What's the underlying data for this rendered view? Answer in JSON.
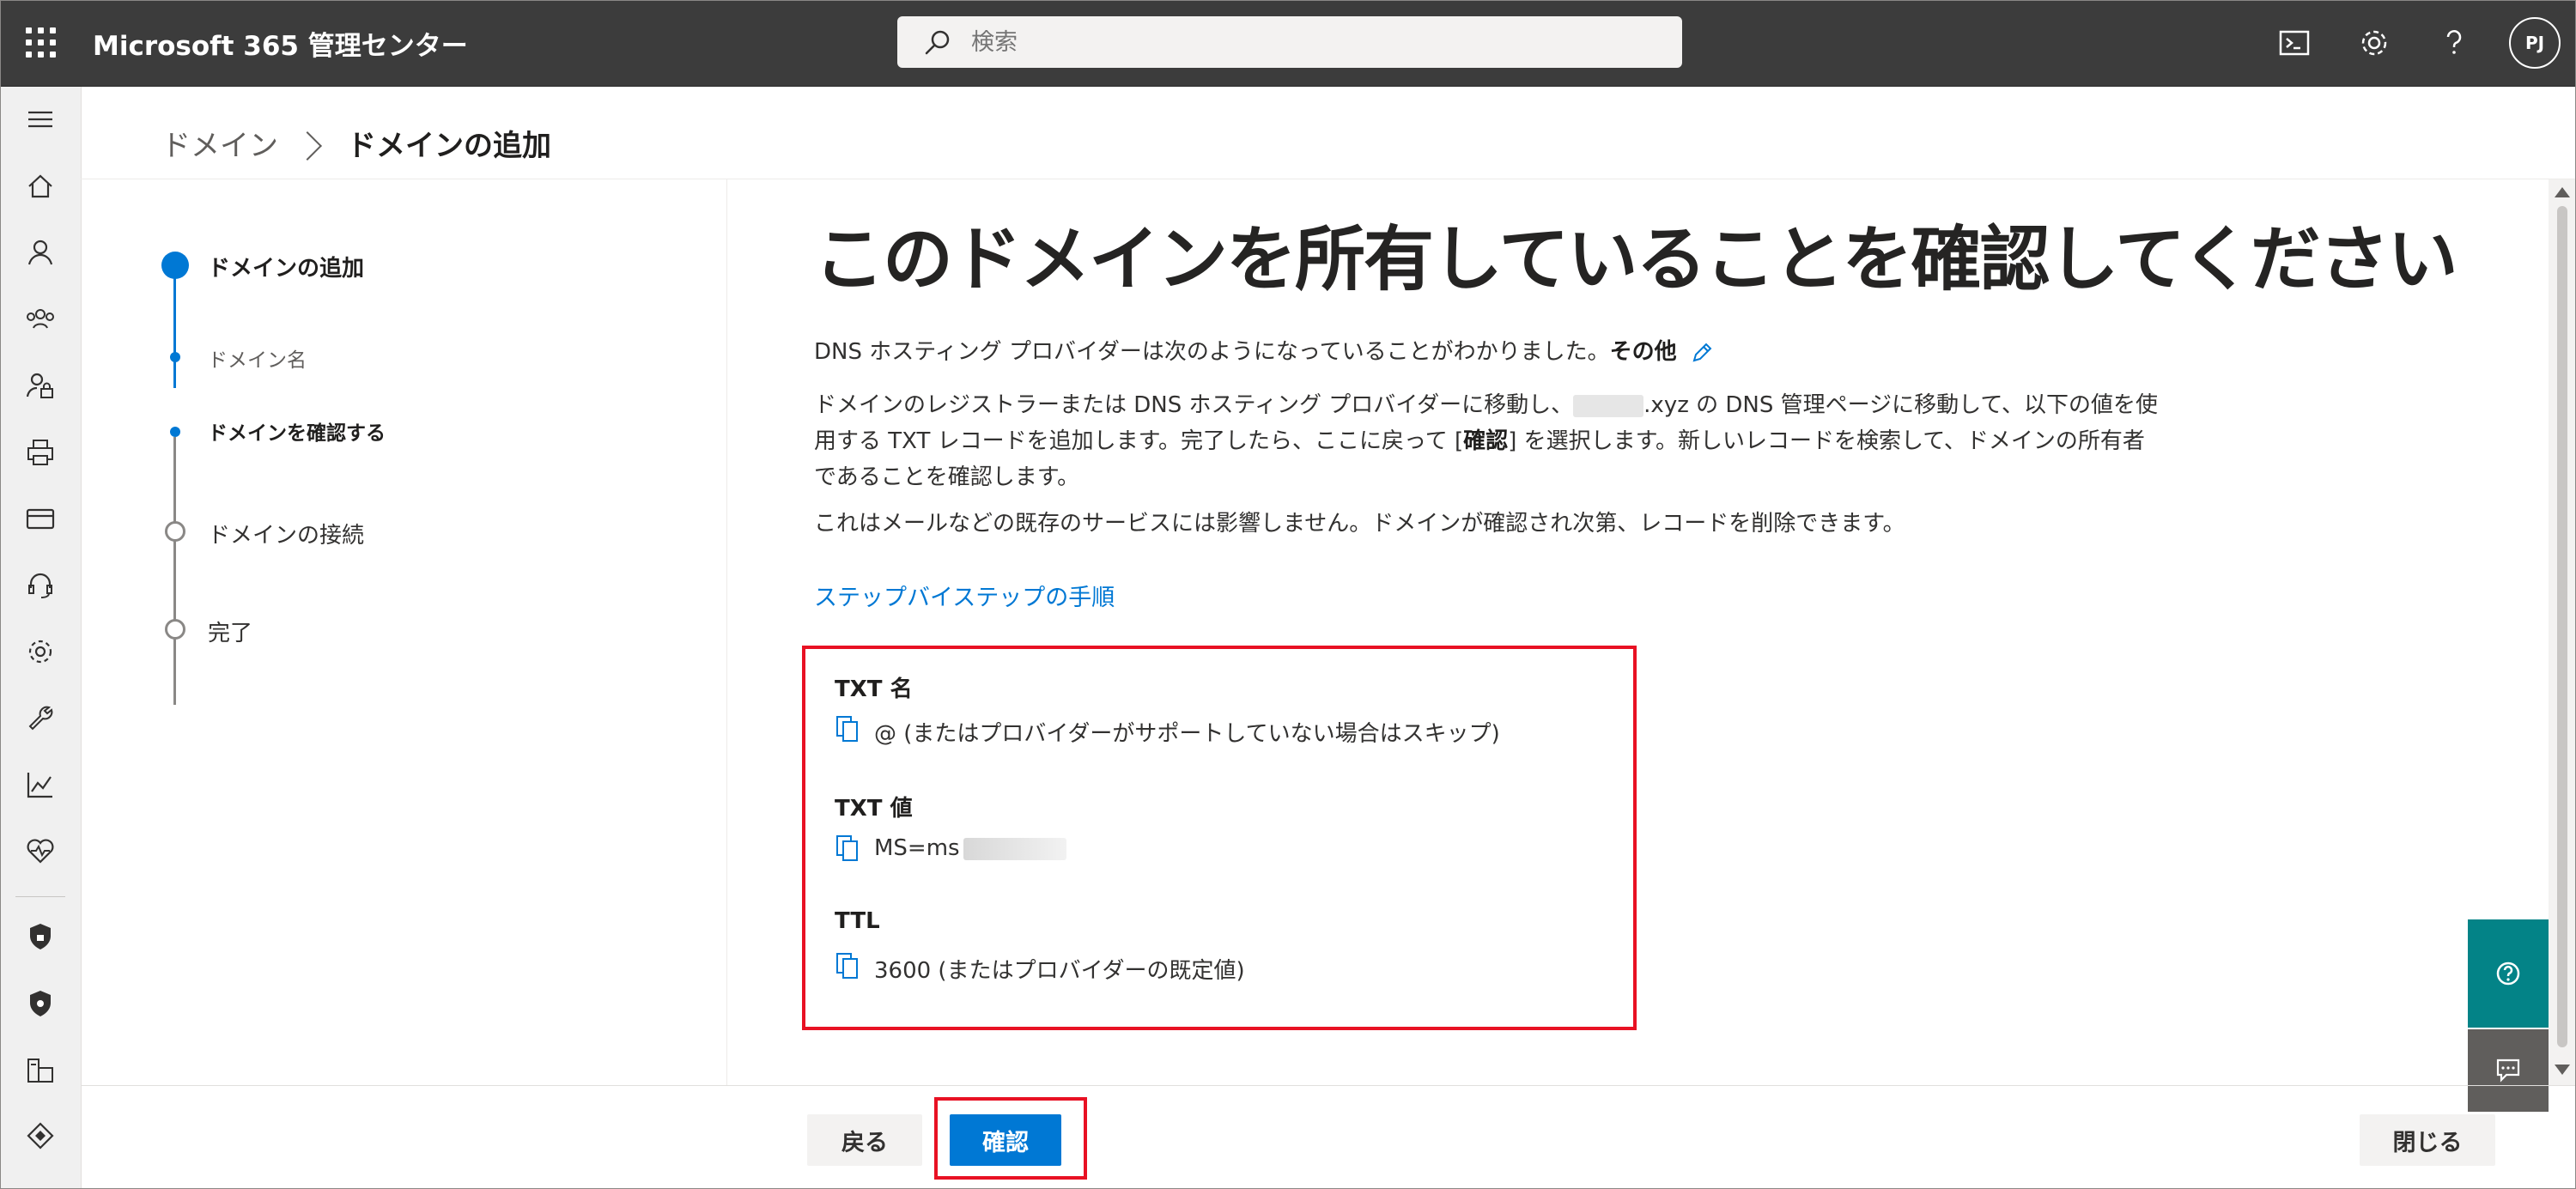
{
  "header": {
    "app_title": "Microsoft 365 管理センター",
    "search_placeholder": "検索",
    "avatar_initials": "PJ"
  },
  "breadcrumb": {
    "parent": "ドメイン",
    "current": "ドメインの追加"
  },
  "wizard": {
    "steps": [
      {
        "label": "ドメインの追加",
        "state": "current"
      },
      {
        "label": "ドメイン名",
        "state": "sub-done"
      },
      {
        "label": "ドメインを確認する",
        "state": "sub-current"
      },
      {
        "label": "ドメインの接続",
        "state": "pending"
      },
      {
        "label": "完了",
        "state": "pending"
      }
    ]
  },
  "main": {
    "title": "このドメインを所有していることを確認してください",
    "provider_text": "DNS ホスティング プロバイダーは次のようになっていることがわかりました。",
    "provider_name": "その他",
    "instructions_line1_a": "ドメインのレジストラーまたは DNS ホスティング プロバイダーに移動し、",
    "instructions_line1_b": ".xyz の DNS 管理ページに移動して、以下の値を使",
    "instructions_line2_a": "用する TXT レコードを追加します。完了したら、ここに戻って [",
    "instructions_confirm_word": "確認",
    "instructions_line2_b": "] を選択します。新しいレコードを検索して、ドメインの所有者",
    "instructions_line3": "であることを確認します。",
    "note": "これはメールなどの既存のサービスには影響しません。ドメインが確認され次第、レコードを削除できます。",
    "step_link": "ステップバイステップの手順"
  },
  "records": {
    "txt_name_label": "TXT 名",
    "txt_name_value": "@ (またはプロバイダーがサポートしていない場合はスキップ)",
    "txt_value_label": "TXT 値",
    "txt_value_value": "MS=ms",
    "ttl_label": "TTL",
    "ttl_value": "3600 (またはプロバイダーの既定値)"
  },
  "footer": {
    "back_label": "戻る",
    "confirm_label": "確認",
    "close_label": "閉じる"
  },
  "colors": {
    "accent": "#0078d4",
    "topbar": "#3c3c3c",
    "highlight": "#e81123",
    "help_button": "#038387"
  },
  "icons": {
    "top": [
      "waffle-icon",
      "terminal-icon",
      "gear-icon",
      "help-icon"
    ],
    "rail": [
      "menu-icon",
      "home-icon",
      "user-icon",
      "group-icon",
      "user-lock-icon",
      "printer-icon",
      "billing-icon",
      "support-icon",
      "settings-icon",
      "wrench-icon",
      "reports-icon",
      "health-icon",
      "shield-icon",
      "shield-icon",
      "admin-center-icon",
      "azure-icon"
    ],
    "record": "copy-icon",
    "edit": "pencil-icon"
  }
}
